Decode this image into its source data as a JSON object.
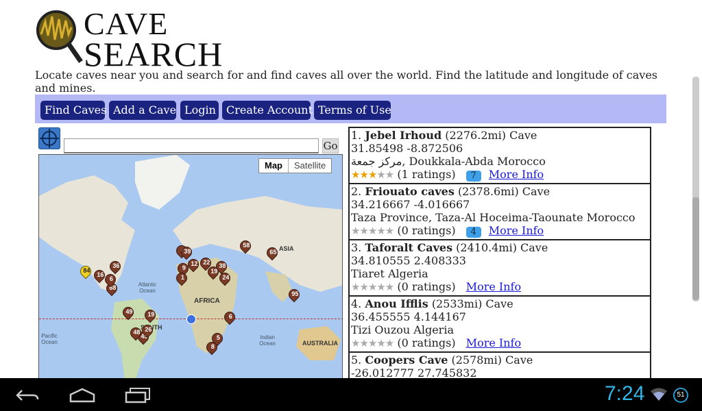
{
  "logo": {
    "line1": "CAVE",
    "line2": "SEARCH"
  },
  "intro": "Locate caves near you and search for and find caves all over the world. Find the latitude and longitude of caves and mines.",
  "nav": [
    {
      "label": "Find Caves"
    },
    {
      "label": "Add a Cave"
    },
    {
      "label": "Login"
    },
    {
      "label": "Create Account"
    },
    {
      "label": "Terms of Use"
    }
  ],
  "search": {
    "go_label": "Go",
    "value": ""
  },
  "map": {
    "map_label": "Map",
    "satellite_label": "Satellite",
    "labels": [
      "AFRICA",
      "SOUTH",
      "AUSTRALIA",
      "ASIA"
    ],
    "oceans": [
      "Atlantic Ocean",
      "Pacific Ocean",
      "Indian Ocean"
    ],
    "markers": [
      "4",
      "39",
      "58",
      "65",
      "9",
      "12",
      "22",
      "38",
      "19",
      "24",
      "1",
      "49",
      "19",
      "6",
      "5",
      "8",
      "95",
      "68",
      "84",
      "45",
      "48",
      "16",
      "6",
      "26",
      "36"
    ]
  },
  "results": [
    {
      "num": "1.",
      "name": "Jebel Irhoud",
      "dist": "(2276.2mi) Cave",
      "coords": "31.85498 -8.872506",
      "region": "مركز جمعة, Doukkala-Abda Morocco",
      "rating": 3,
      "ratings_text": "(1 ratings)",
      "comments": "7",
      "more": "More Info"
    },
    {
      "num": "2.",
      "name": "Friouato caves",
      "dist": "(2378.6mi) Cave",
      "coords": "34.216667 -4.016667",
      "region": "Taza Province, Taza-Al Hoceima-Taounate Morocco",
      "rating": 0,
      "ratings_text": "(0 ratings)",
      "comments": "4",
      "more": "More Info"
    },
    {
      "num": "3.",
      "name": "Taforalt Caves",
      "dist": "(2410.4mi) Cave",
      "coords": "34.810555 2.408333",
      "region": "Tiaret Algeria",
      "rating": 0,
      "ratings_text": "(0 ratings)",
      "comments": "",
      "more": "More Info"
    },
    {
      "num": "4.",
      "name": "Anou Ifflis",
      "dist": "(2533mi) Cave",
      "coords": "36.455555 4.144167",
      "region": "Tizi Ouzou Algeria",
      "rating": 0,
      "ratings_text": "(0 ratings)",
      "comments": "",
      "more": "More Info"
    },
    {
      "num": "5.",
      "name": "Coopers Cave",
      "dist": "(2578mi) Cave",
      "coords": "-26.012777 27.745832",
      "region": "",
      "rating": 0,
      "ratings_text": "",
      "comments": "",
      "more": ""
    }
  ],
  "system": {
    "time": "7:24",
    "battery": "51"
  },
  "colors": {
    "nav_bg": "#b4b8f4",
    "nav_button": "#1a2480",
    "link": "#1a1ad8",
    "clock": "#33b5e5",
    "marker": "#7a3a26"
  }
}
